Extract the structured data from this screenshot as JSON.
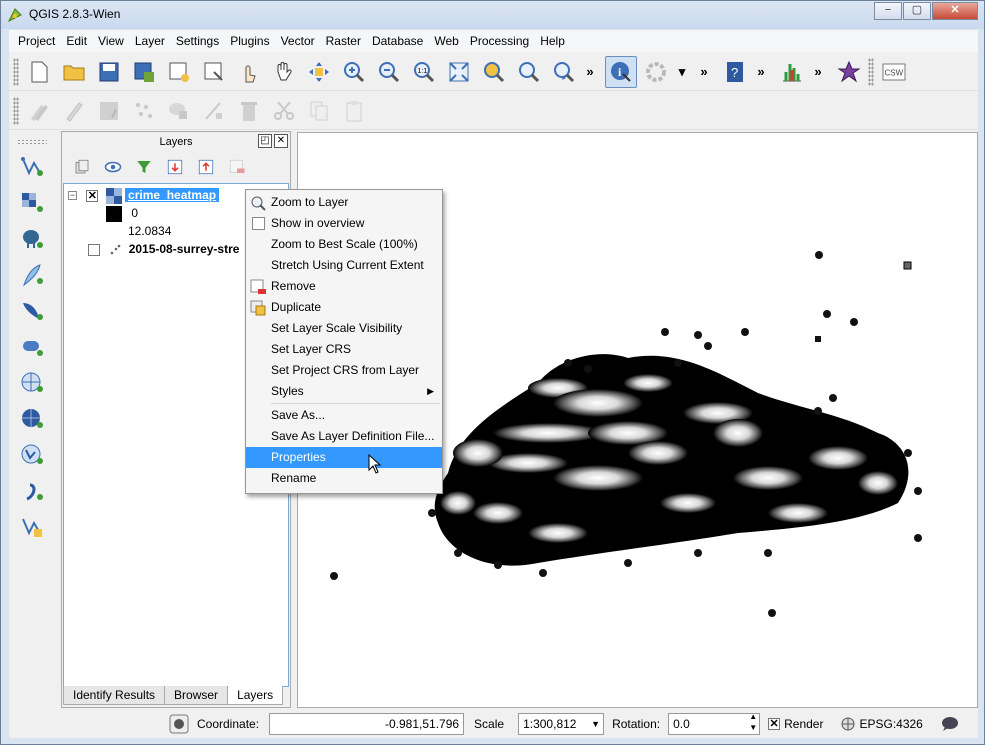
{
  "window": {
    "title": "QGIS 2.8.3-Wien",
    "min": "−",
    "max": "▢",
    "close": "✕"
  },
  "menubar": [
    "Project",
    "Edit",
    "View",
    "Layer",
    "Settings",
    "Plugins",
    "Vector",
    "Raster",
    "Database",
    "Web",
    "Processing",
    "Help"
  ],
  "toolbar": {
    "more": "»",
    "csw": "CSW"
  },
  "layers_panel": {
    "title": "Layers",
    "float_btn": "◰",
    "close_btn": "✕",
    "layers": [
      {
        "name": "crime_heatmap",
        "checked": true,
        "legend": [
          "0",
          "12.0834"
        ]
      },
      {
        "name": "2015-08-surrey-stre",
        "checked": false
      }
    ],
    "expand": "−",
    "check_mark": "✕"
  },
  "tabs": [
    "Identify Results",
    "Browser",
    "Layers"
  ],
  "context_menu": {
    "items": [
      {
        "label": "Zoom to Layer",
        "icon": "zoom-to-layer-icon"
      },
      {
        "label": "Show in overview",
        "icon": "checkbox"
      },
      {
        "label": "Zoom to Best Scale (100%)"
      },
      {
        "label": "Stretch Using Current Extent"
      },
      {
        "label": "Remove",
        "icon": "remove-layer-icon"
      },
      {
        "label": "Duplicate",
        "icon": "duplicate-layer-icon"
      },
      {
        "label": "Set Layer Scale Visibility"
      },
      {
        "label": "Set Layer CRS"
      },
      {
        "label": "Set Project CRS from Layer"
      },
      {
        "label": "Styles",
        "submenu": true
      },
      {
        "label": "Save As..."
      },
      {
        "label": "Save As Layer Definition File..."
      },
      {
        "label": "Properties",
        "selected": true
      },
      {
        "label": "Rename"
      }
    ],
    "submenu_arrow": "▶"
  },
  "statusbar": {
    "coordinate_label": "Coordinate:",
    "coordinate_value": "-0.981,51.796",
    "scale_label": "Scale",
    "scale_value": "1:300,812",
    "rotation_label": "Rotation:",
    "rotation_value": "0.0",
    "render_label": "Render",
    "render_checked": "✕",
    "crs": "EPSG:4326"
  },
  "colors": {
    "accent": "#3399ff",
    "canvas": "#ffffff",
    "heat_black": "#000000"
  }
}
